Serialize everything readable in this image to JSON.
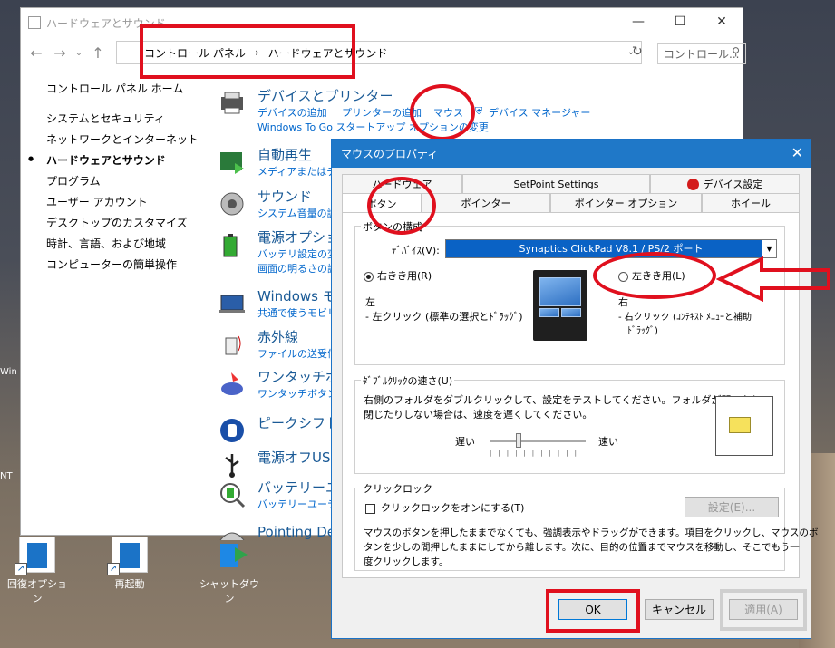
{
  "desktop": {
    "icons": [
      {
        "label": "回復オプション"
      },
      {
        "label": "再起動"
      },
      {
        "label": "シャットダウン"
      }
    ],
    "left_stubs": [
      "Win",
      "NT"
    ]
  },
  "control_panel": {
    "window_title": "ハードウェアとサウンド",
    "window_buttons": {
      "minimize": "—",
      "maximize": "☐",
      "close": "✕"
    },
    "address": {
      "segment1": "コントロール パネル",
      "separator": "›",
      "segment2": "ハードウェアとサウンド"
    },
    "search_placeholder": "コントロール...",
    "sidebar": {
      "home": "コントロール パネル ホーム",
      "items": [
        "システムとセキュリティ",
        "ネットワークとインターネット",
        "ハードウェアとサウンド",
        "プログラム",
        "ユーザー アカウント",
        "デスクトップのカスタマイズ",
        "時計、言語、および地域",
        "コンピューターの簡単操作"
      ]
    },
    "categories": {
      "devices": {
        "title": "デバイスとプリンター",
        "links": [
          "デバイスの追加",
          "プリンターの追加",
          "マウス",
          "デバイス マネージャー"
        ],
        "sub2": "Windows To Go スタートアップ オプションの変更"
      },
      "autoplay": {
        "title": "自動再生",
        "sub": "メディアまたはデバイス"
      },
      "sound": {
        "title": "サウンド",
        "sub": "システム音量の調"
      },
      "power": {
        "title": "電源オプション",
        "sub": "バッテリ設定の変更",
        "sub2": "画面の明るさの調"
      },
      "mobility": {
        "title": "Windows モ",
        "sub": "共通で使うモビリ"
      },
      "infrared": {
        "title": "赤外線",
        "sub": "ファイルの送受信"
      },
      "onetouch": {
        "title": "ワンタッチボタ",
        "sub": "ワンタッチボタンの"
      },
      "peakshift": {
        "title": "ピークシフト設"
      },
      "usbpower": {
        "title": "電源オフUSB"
      },
      "battery": {
        "title": "バッテリーユー",
        "sub": "バッテリーユーティリ"
      },
      "pointing": {
        "title": "Pointing De"
      }
    }
  },
  "dialog": {
    "title": "マウスのプロパティ",
    "close": "✕",
    "tabs_row1": [
      "ハードウェア",
      "SetPoint Settings",
      "デバイス設定"
    ],
    "tabs_row2": [
      "ボタン",
      "ポインター",
      "ポインター オプション",
      "ホイール"
    ],
    "button_config": {
      "legend": "ボタンの構成",
      "device_label": "ﾃﾞﾊﾞｲｽ(V):",
      "device_value": "Synaptics ClickPad V8.1 / PS/2 ポート",
      "right_handed": "右きき用(R)",
      "left_handed": "左きき用(L)",
      "left_title": "左",
      "left_desc": "- 左クリック (標準の選択とﾄﾞﾗｯｸﾞ)",
      "right_title": "右",
      "right_desc1": "- 右クリック (ｺﾝﾃｷｽﾄ ﾒﾆｭｰと補助",
      "right_desc2": "ﾄﾞﾗｯｸﾞ)"
    },
    "double_click": {
      "legend": "ﾀﾞﾌﾞﾙｸﾘｯｸの速さ(U)",
      "desc1": "右側のフォルダをダブルクリックして、設定をテストしてください。フォルダが開いたり",
      "desc2": "閉じたりしない場合は、速度を遅くしてください。",
      "slow": "遅い",
      "fast": "速い",
      "speed_fraction": 0.3
    },
    "click_lock": {
      "legend": "クリックロック",
      "checkbox": "クリックロックをオンにする(T)",
      "settings_button": "設定(E)...",
      "desc1": "マウスのボタンを押したままでなくても、強調表示やドラッグができます。項目をクリックし、マウスのボ",
      "desc2": "タンを少しの間押したままにしてから離します。次に、目的の位置までマウスを移動し、そこでもう一",
      "desc3": "度クリックします。"
    },
    "buttons": {
      "ok": "OK",
      "cancel": "キャンセル",
      "apply": "適用(A)"
    }
  },
  "colors": {
    "accent": "#1f78c8",
    "annotation": "#e0101e",
    "link": "#0066cc"
  }
}
